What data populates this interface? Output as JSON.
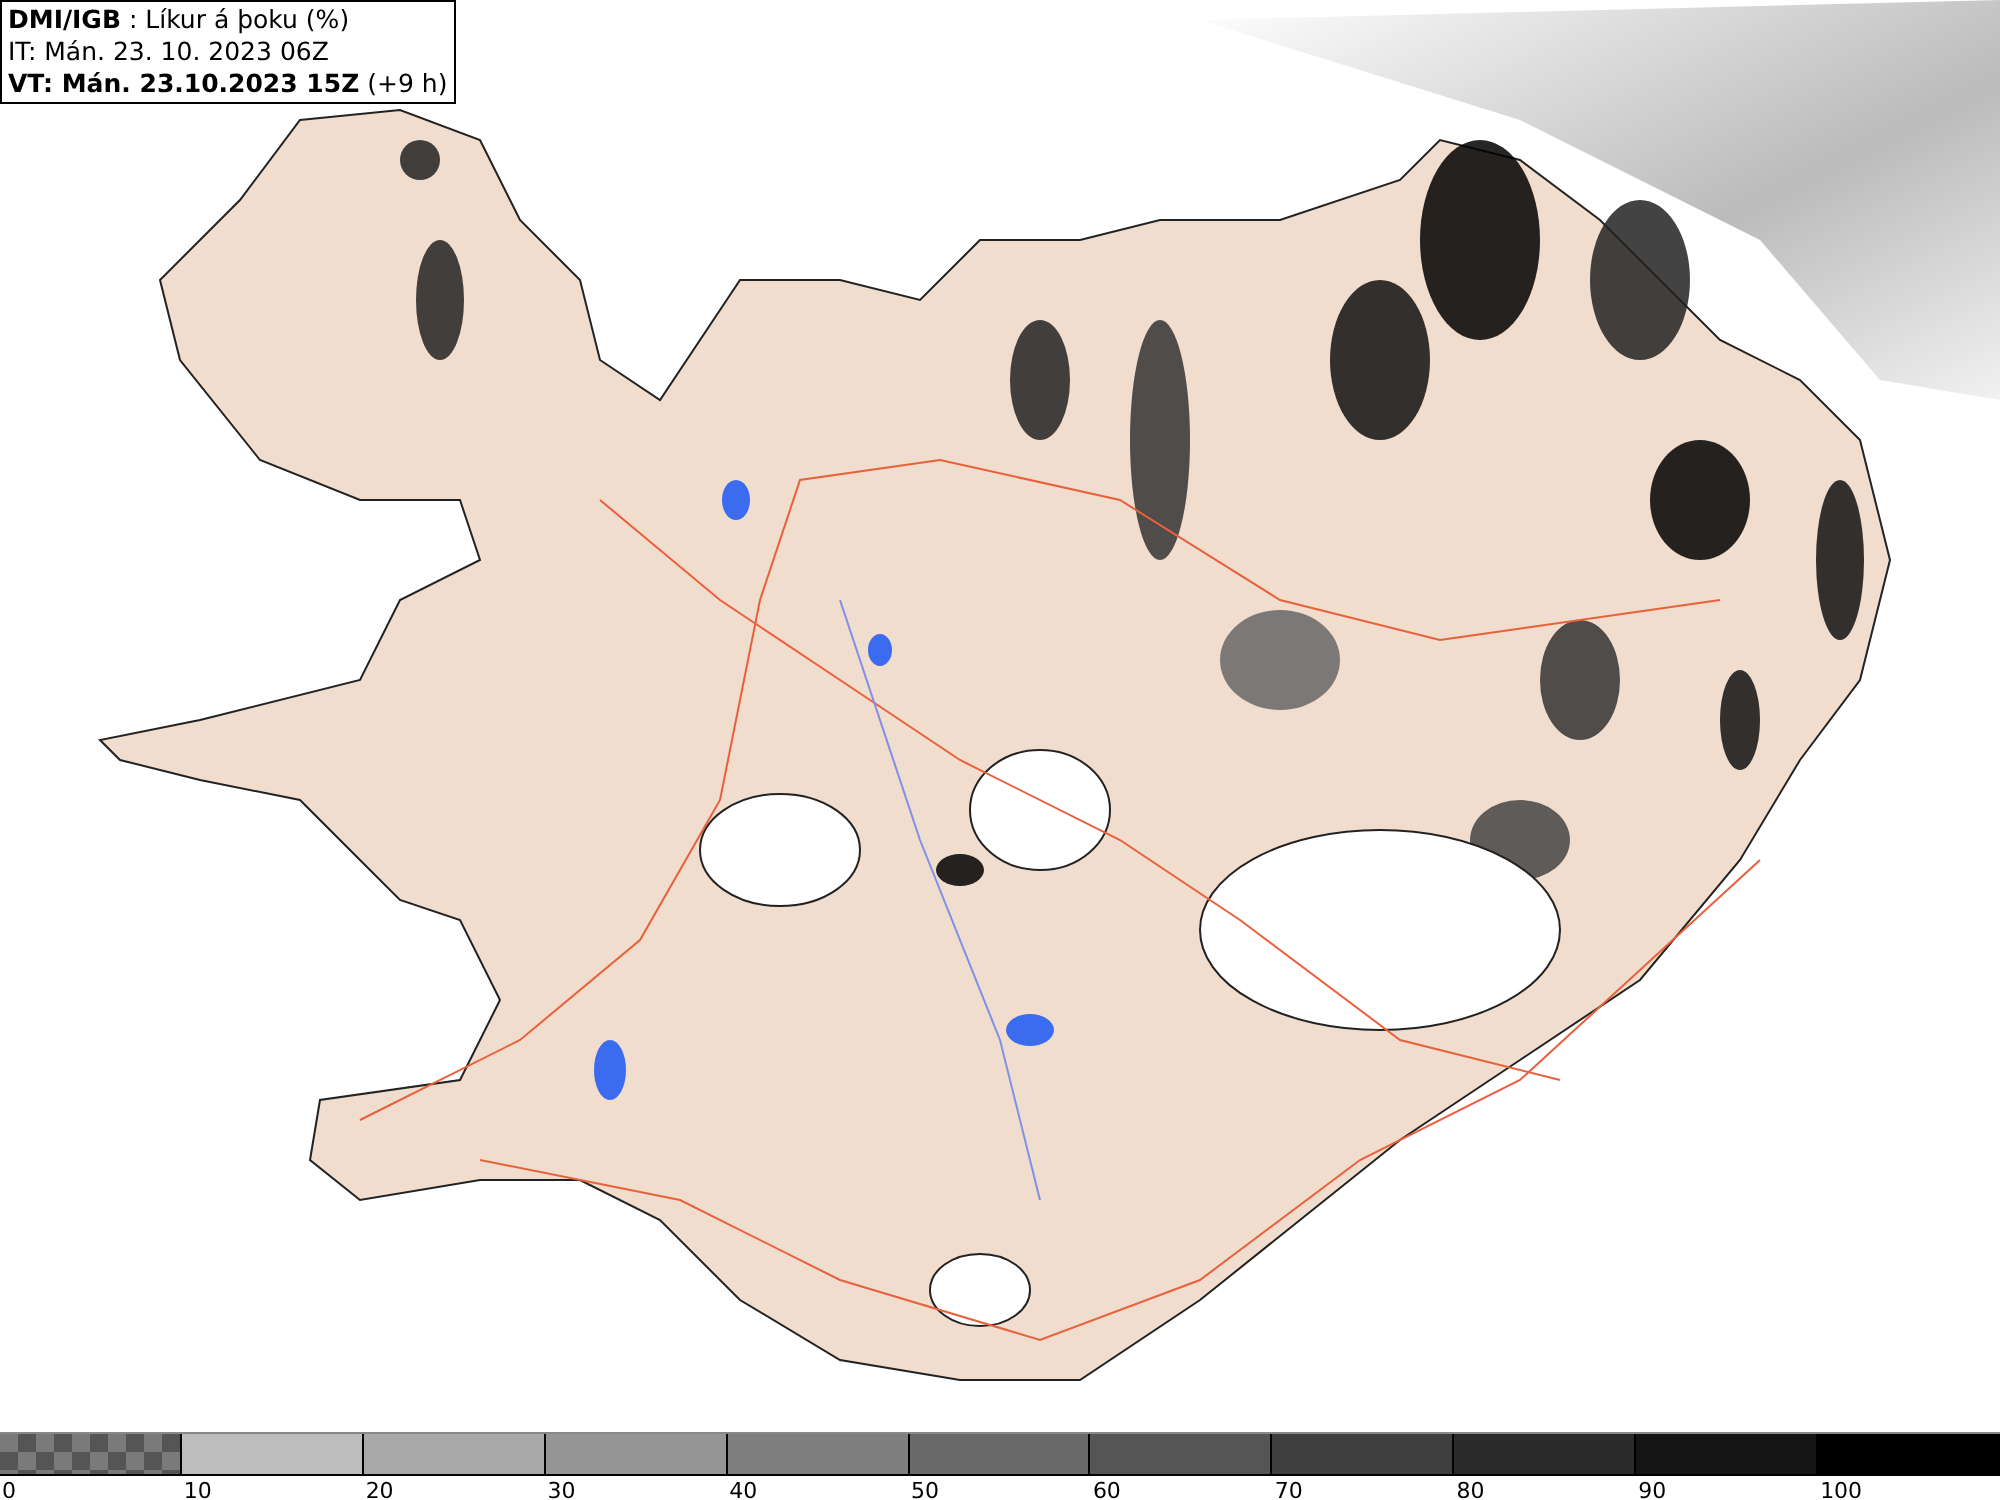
{
  "header": {
    "lines": [
      "**DMI/IGB** : Líkur á þoku (%)",
      "IT: Mán. 23. 10. 2023 06Z",
      "**VT: Mán. 23.10.2023 15Z** (+9 h)"
    ]
  },
  "legend": [
    {
      "label": "0",
      "kind": "checkered",
      "color": "#7a7a7a"
    },
    {
      "label": "10",
      "kind": "solid",
      "color": "#bdbdbd"
    },
    {
      "label": "20",
      "kind": "solid",
      "color": "#a9a9a9"
    },
    {
      "label": "30",
      "kind": "solid",
      "color": "#959595"
    },
    {
      "label": "40",
      "kind": "solid",
      "color": "#7f7f7f"
    },
    {
      "label": "50",
      "kind": "solid",
      "color": "#6a6a6a"
    },
    {
      "label": "60",
      "kind": "solid",
      "color": "#555555"
    },
    {
      "label": "70",
      "kind": "solid",
      "color": "#3f3f3f"
    },
    {
      "label": "80",
      "kind": "solid",
      "color": "#2a2a2a"
    },
    {
      "label": "90",
      "kind": "solid",
      "color": "#151515"
    },
    {
      "label": "100",
      "kind": "solid",
      "color": "#000000"
    }
  ]
}
